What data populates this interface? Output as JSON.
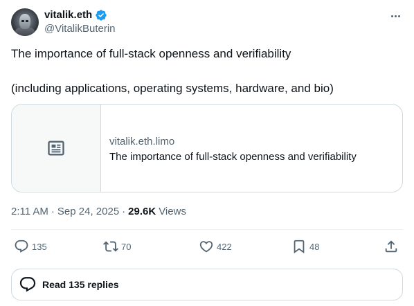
{
  "author": {
    "display_name": "vitalik.eth",
    "handle": "@VitalikButerin"
  },
  "tweet": {
    "line1": "The importance of full-stack openness and verifiability",
    "line2": "(including applications, operating systems, hardware, and bio)"
  },
  "card": {
    "domain": "vitalik.eth.limo",
    "title": "The importance of full-stack openness and verifiability",
    "thumb_icon": "article-icon"
  },
  "meta": {
    "time": "2:11 AM",
    "dot1": "·",
    "date": "Sep 24, 2025",
    "dot2": "·",
    "views_count": "29.6K",
    "views_label": "Views"
  },
  "actions": {
    "replies": "135",
    "reposts": "70",
    "likes": "422",
    "bookmarks": "48"
  },
  "read_replies_label": "Read 135 replies",
  "colors": {
    "text_primary": "#0f1419",
    "text_secondary": "#536471",
    "border": "#cfd9de",
    "verified": "#1d9bf0"
  },
  "icons": [
    "verified-badge-icon",
    "more-icon",
    "article-icon",
    "reply-icon",
    "repost-icon",
    "like-icon",
    "bookmark-icon",
    "share-icon",
    "replies-bubble-icon"
  ]
}
